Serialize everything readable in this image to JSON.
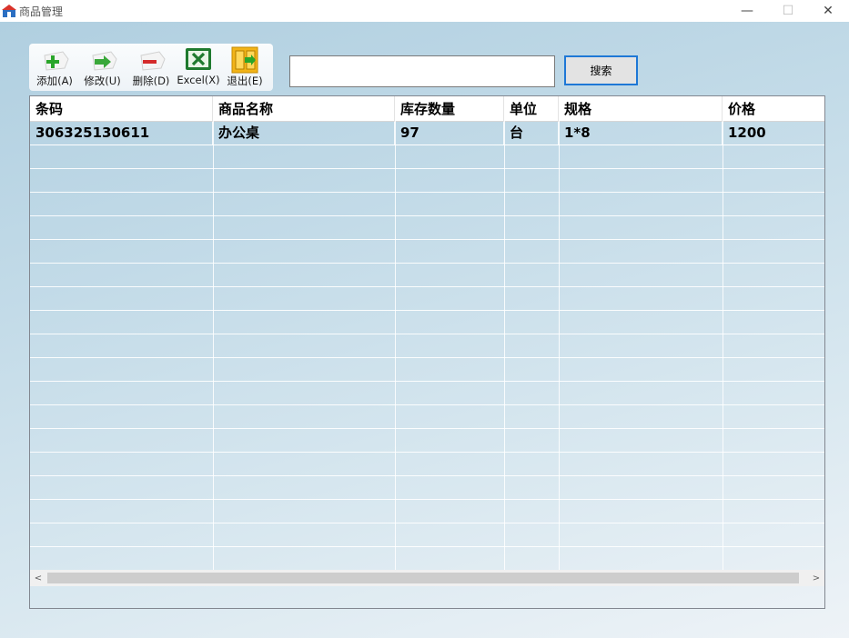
{
  "window": {
    "title": "商品管理",
    "minimize_glyph": "—",
    "maximize_glyph": "☐",
    "close_glyph": "✕"
  },
  "toolbar": {
    "add_label": "添加(A)",
    "edit_label": "修改(U)",
    "delete_label": "删除(D)",
    "excel_label": "Excel(X)",
    "exit_label": "退出(E)"
  },
  "search": {
    "value": "",
    "placeholder": "",
    "button_label": "搜索"
  },
  "grid": {
    "columns": [
      "条码",
      "商品名称",
      "库存数量",
      "单位",
      "规格",
      "价格"
    ],
    "rows": [
      [
        "306325130611",
        "办公桌",
        "97",
        "台",
        "1*8",
        "1200"
      ]
    ]
  },
  "scrollbar": {
    "left_arrow": "<",
    "right_arrow": ">"
  },
  "colors": {
    "accent_border": "#1e78d6",
    "background_top": "#b0cfe0",
    "background_bottom": "#eef3f7"
  }
}
